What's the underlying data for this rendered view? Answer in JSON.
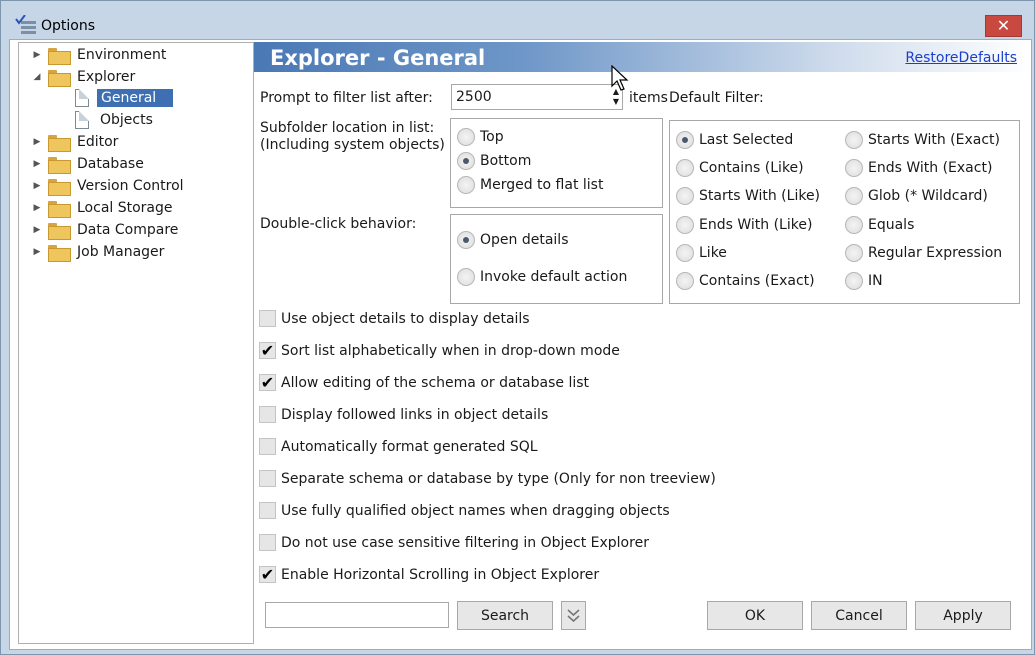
{
  "window": {
    "title": "Options",
    "close_glyph": "✕"
  },
  "tree": {
    "items": [
      {
        "label": "Environment",
        "expander": "▶",
        "icon": "folder-icon"
      },
      {
        "label": "Explorer",
        "expander": "◢",
        "icon": "folder-open-icon"
      },
      {
        "label": "General",
        "expander": "",
        "icon": "document-icon",
        "selected": true
      },
      {
        "label": "Objects",
        "expander": "",
        "icon": "document-icon"
      },
      {
        "label": "Editor",
        "expander": "▶",
        "icon": "folder-icon"
      },
      {
        "label": "Database",
        "expander": "▶",
        "icon": "folder-icon"
      },
      {
        "label": "Version Control",
        "expander": "▶",
        "icon": "folder-icon"
      },
      {
        "label": "Local Storage",
        "expander": "▶",
        "icon": "folder-icon"
      },
      {
        "label": "Data Compare",
        "expander": "▶",
        "icon": "folder-icon"
      },
      {
        "label": "Job Manager",
        "expander": "▶",
        "icon": "folder-icon"
      }
    ]
  },
  "header": {
    "title": "Explorer - General",
    "restore_defaults": "RestoreDefaults"
  },
  "prompt": {
    "label": "Prompt to filter list after:",
    "value": "2500",
    "unit": "items",
    "up": "▲",
    "down": "▼"
  },
  "default_filter": {
    "label": "Default Filter:",
    "options_col1": [
      "Last Selected",
      "Contains (Like)",
      "Starts With (Like)",
      "Ends With (Like)",
      "Like",
      "Contains (Exact)"
    ],
    "options_col2": [
      "Starts With (Exact)",
      "Ends With (Exact)",
      "Glob (* Wildcard)",
      "Equals",
      "Regular Expression",
      "IN"
    ],
    "selected": "Last Selected"
  },
  "subfolder": {
    "label_line1": "Subfolder location in list:",
    "label_line2": "(Including system objects)",
    "options": [
      "Top",
      "Bottom",
      "Merged to flat list"
    ],
    "selected": "Bottom"
  },
  "double_click": {
    "label": "Double-click behavior:",
    "options": [
      "Open details",
      "Invoke default action"
    ],
    "selected": "Open details"
  },
  "checkboxes": [
    {
      "label": "Use object details to display details",
      "checked": false
    },
    {
      "label": "Sort list alphabetically when in drop-down mode",
      "checked": true
    },
    {
      "label": "Allow editing of the schema or database list",
      "checked": true
    },
    {
      "label": "Display followed links in object details",
      "checked": false
    },
    {
      "label": "Automatically format generated SQL",
      "checked": false
    },
    {
      "label": "Separate schema or database by type (Only for non treeview)",
      "checked": false
    },
    {
      "label": "Use fully qualified object names when dragging objects",
      "checked": false
    },
    {
      "label": "Do not use case sensitive filtering in Object Explorer",
      "checked": false
    },
    {
      "label": "Enable Horizontal Scrolling in Object Explorer",
      "checked": true
    }
  ],
  "check_glyph": "✔",
  "footer": {
    "search_value": "",
    "search_label": "Search",
    "ok_label": "OK",
    "cancel_label": "Cancel",
    "apply_label": "Apply"
  }
}
